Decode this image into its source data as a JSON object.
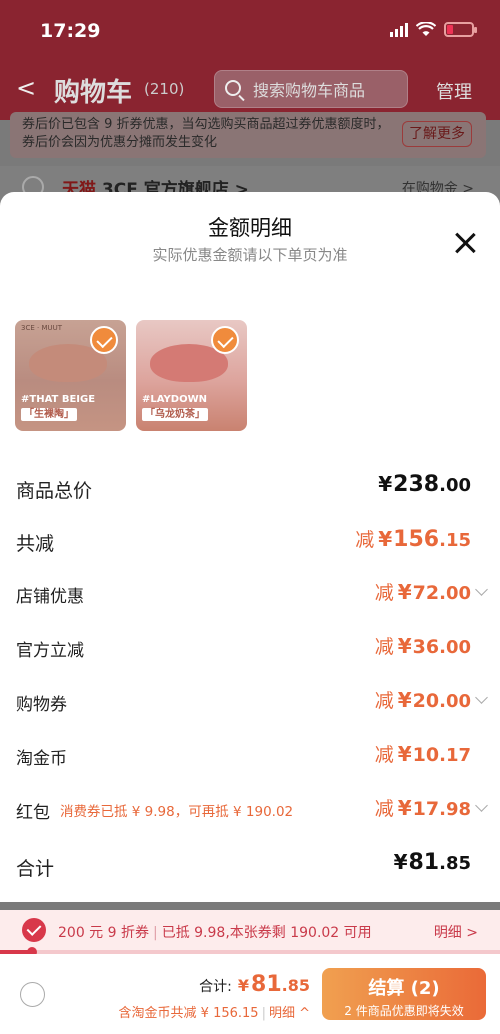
{
  "status_bar": {
    "time": "17:29"
  },
  "header": {
    "back": "<",
    "title": "购物车",
    "count": "(210)",
    "search_placeholder": "搜索购物车商品",
    "manage": "管理"
  },
  "notice": {
    "text": "券后价已包含 9 折券优惠，当勾选购买商品超过券优惠额度时，券后价会因为优惠分摊而发生变化",
    "learn_more": "了解更多"
  },
  "store": {
    "tmall": "天猫",
    "name": "3CE 官方旗舰店 >",
    "right": "在购物金 >"
  },
  "sheet": {
    "title": "金额明细",
    "subtitle": "实际优惠金额请以下单页为准"
  },
  "products": [
    {
      "brand": "3CE · MUUT",
      "caption": "#THAT BEIGE",
      "tag": "「生裸陶」"
    },
    {
      "brand": "",
      "caption": "#LAYDOWN",
      "tag": "「乌龙奶茶」"
    }
  ],
  "rows": {
    "goods_total": {
      "label": "商品总价",
      "yen": "¥",
      "int": "238",
      "dec": ".00"
    },
    "total_reduction": {
      "label": "共减",
      "prefix": "减",
      "yen": "¥",
      "int": "156",
      "dec": ".15"
    },
    "store_discount": {
      "label": "店铺优惠",
      "prefix": "减",
      "yen": "¥",
      "int": "72",
      "dec": ".00"
    },
    "official_discount": {
      "label": "官方立减",
      "prefix": "减",
      "yen": "¥",
      "int": "36",
      "dec": ".00"
    },
    "shopping_coupon": {
      "label": "购物券",
      "prefix": "减",
      "yen": "¥",
      "int": "20",
      "dec": ".00"
    },
    "taojinbi": {
      "label": "淘金币",
      "prefix": "减",
      "yen": "¥",
      "int": "10",
      "dec": ".17"
    },
    "red_packet": {
      "label": "红包",
      "note": "消费券已抵 ¥ 9.98，可再抵 ¥ 190.02",
      "prefix": "减",
      "yen": "¥",
      "int": "17",
      "dec": ".98"
    },
    "subtotal": {
      "label": "合计",
      "yen": "¥",
      "int": "81",
      "dec": ".85"
    }
  },
  "coupon_bar": {
    "text1": "200 元 9 折券",
    "sep": "|",
    "text2": "已抵 9.98,本张券剩 190.02 可用",
    "detail": "明细 >"
  },
  "footer": {
    "total_label": "合计:",
    "yen": "¥",
    "int": "81",
    "dec": ".85",
    "saving": "含淘金币共减 ¥ 156.15",
    "saving_sep": "|",
    "detail": "明细 ^",
    "checkout": "结算 (2)",
    "checkout_sub": "2 件商品优惠即将失效"
  },
  "colors": {
    "accent": "#e8683a",
    "coupon_red": "#d8384a",
    "header_dim": "#8a2430"
  }
}
